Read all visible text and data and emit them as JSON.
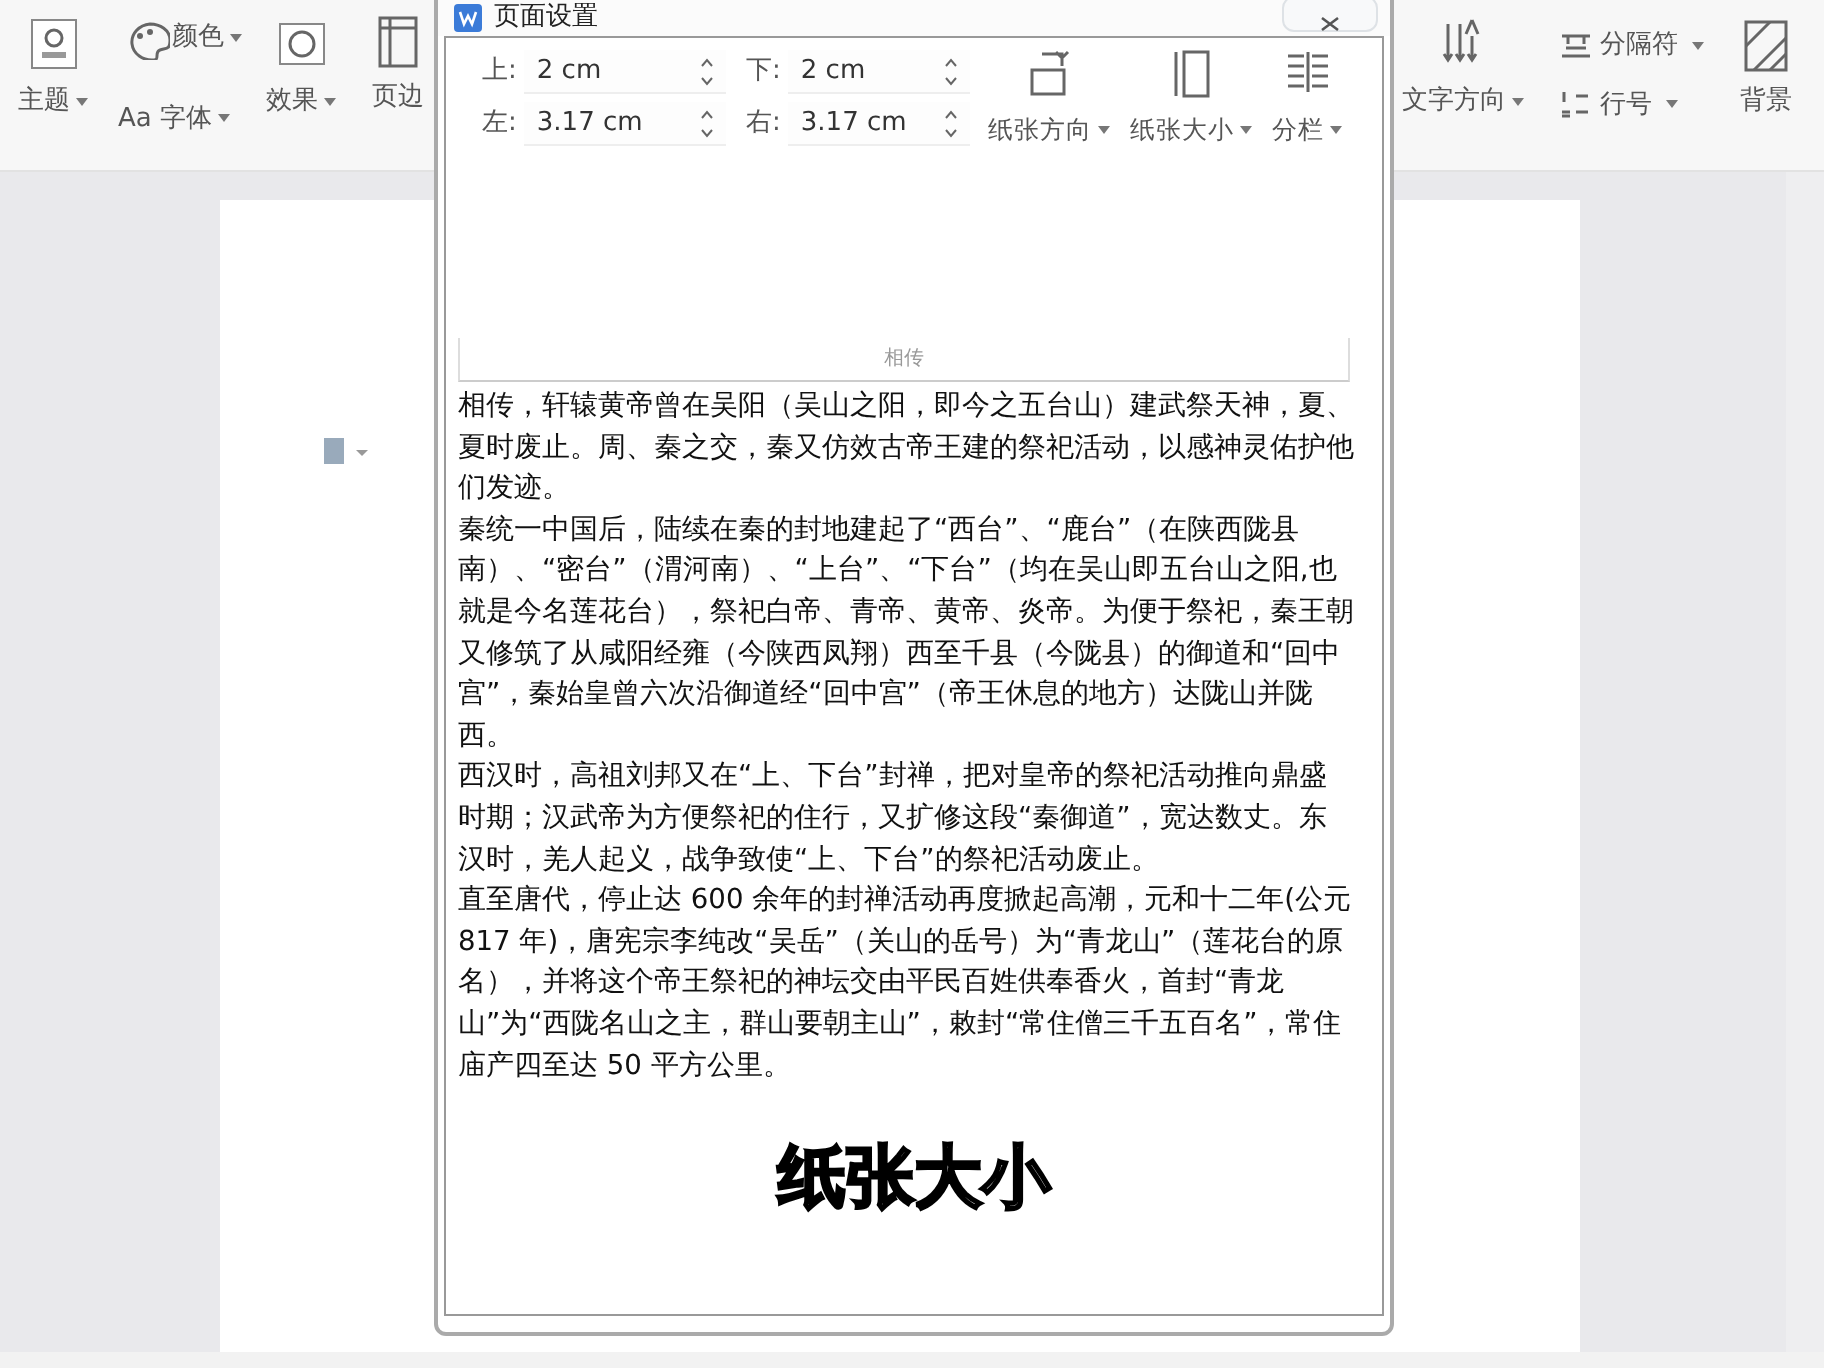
{
  "ribbon_left": [
    {
      "kind": "theme",
      "label": "主题"
    },
    {
      "kind": "color",
      "label": "颜色"
    },
    {
      "kind": "font",
      "prefix": "Aa",
      "label": "字体"
    },
    {
      "kind": "effect",
      "label": "效果"
    },
    {
      "kind": "margin",
      "label": "页边"
    }
  ],
  "dialog": {
    "title": "页面设置",
    "margins": [
      {
        "label": "上:",
        "value": "2 cm"
      },
      {
        "label": "下:",
        "value": "2 cm"
      },
      {
        "label": "左:",
        "value": "3.17 cm"
      },
      {
        "label": "右:",
        "value": "3.17 cm"
      }
    ],
    "tools": [
      {
        "kind": "orientation",
        "label": "纸张方向"
      },
      {
        "kind": "size",
        "label": "纸张大小"
      },
      {
        "kind": "columns",
        "label": "分栏"
      }
    ],
    "header_text": "相传",
    "paragraphs": [
      "相传，轩辕黄帝曾在吴阳（吴山之阳，即今之五台山）建武祭天神，夏、夏时废止。周、秦之交，秦又仿效古帝王建的祭祀活动，以感神灵佑护他们发迹。",
      "秦统一中国后，陆续在秦的封地建起了“西台”、“鹿台”（在陕西陇县南）、“密台”（渭河南）、“上台”、“下台”（均在吴山即五台山之阳,也就是今名莲花台），祭祀白帝、青帝、黄帝、炎帝。为便于祭祀，秦王朝又修筑了从咸阳经雍（今陕西凤翔）西至千县（今陇县）的御道和“回中宫”，秦始皇曾六次沿御道经“回中宫”（帝王休息的地方）达陇山并陇西。",
      "西汉时，高祖刘邦又在“上、下台”封禅，把对皇帝的祭祀活动推向鼎盛时期；汉武帝为方便祭祀的住行，又扩修这段“秦御道”，宽达数丈。东汉时，羌人起义，战争致使“上、下台”的祭祀活动废止。",
      "直至唐代，停止达 600 余年的封禅活动再度掀起高潮，元和十二年(公元 817 年)，唐宪宗李纯改“吴岳”（关山的岳号）为“青龙山”（莲花台的原名），并将这个帝王祭祀的神坛交由平民百姓供奉香火，首封“青龙山”为“西陇名山之主，群山要朝主山”，敕封“常住僧三千五百名”，常住庙产四至达 50 平方公里。"
    ],
    "caption": "纸张大小"
  },
  "ribbon_right": [
    {
      "kind": "text-direction",
      "label": "文字方向"
    },
    {
      "kind": "separator",
      "label": "分隔符"
    },
    {
      "kind": "line-number",
      "label": "行号"
    },
    {
      "kind": "background",
      "label": "背景"
    }
  ]
}
